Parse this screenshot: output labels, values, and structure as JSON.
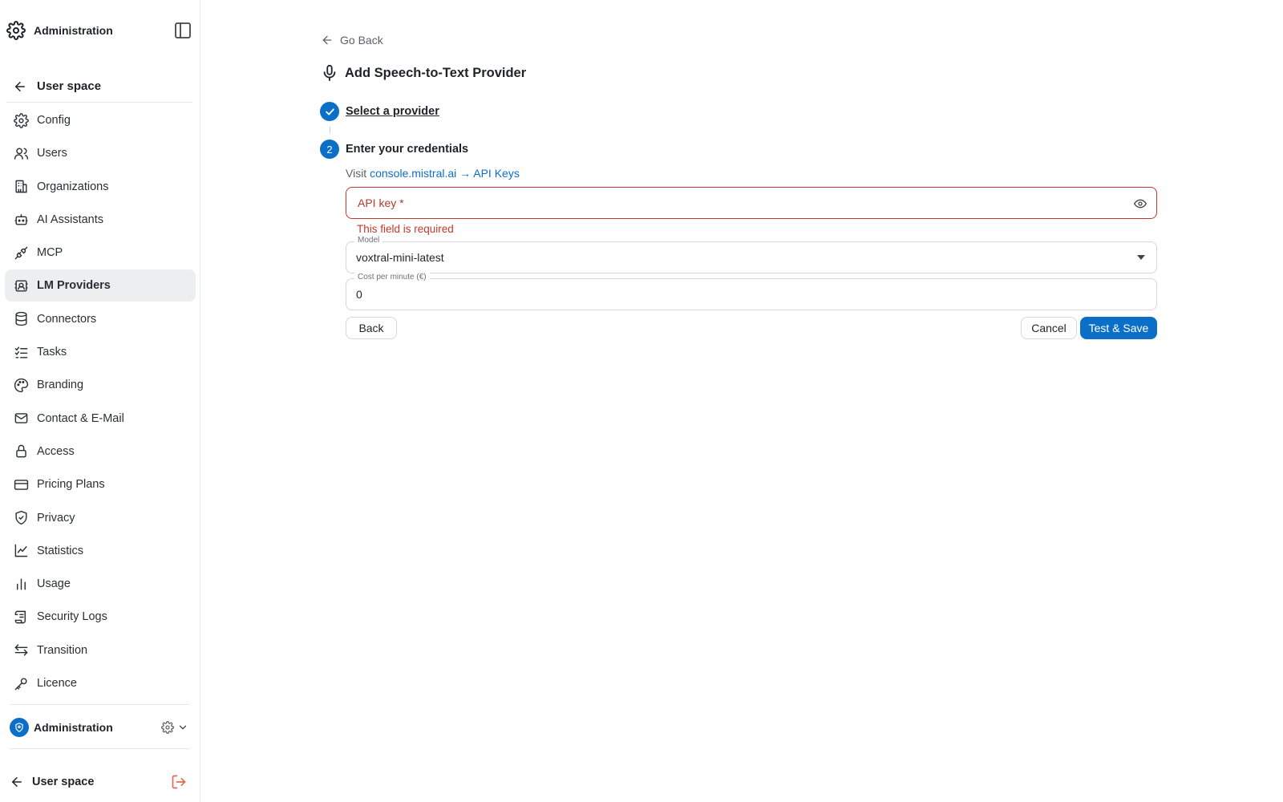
{
  "sidebar": {
    "header_title": "Administration",
    "back_label": "User space",
    "items": [
      {
        "label": "Config",
        "icon": "gear-icon",
        "active": false
      },
      {
        "label": "Users",
        "icon": "users-icon",
        "active": false
      },
      {
        "label": "Organizations",
        "icon": "building-icon",
        "active": false
      },
      {
        "label": "AI Assistants",
        "icon": "bot-icon",
        "active": false
      },
      {
        "label": "MCP",
        "icon": "plug-icon",
        "active": false
      },
      {
        "label": "LM Providers",
        "icon": "cpu-icon",
        "active": true
      },
      {
        "label": "Connectors",
        "icon": "database-icon",
        "active": false
      },
      {
        "label": "Tasks",
        "icon": "checklist-icon",
        "active": false
      },
      {
        "label": "Branding",
        "icon": "palette-icon",
        "active": false
      },
      {
        "label": "Contact & E-Mail",
        "icon": "mail-icon",
        "active": false
      },
      {
        "label": "Access",
        "icon": "lock-icon",
        "active": false
      },
      {
        "label": "Pricing Plans",
        "icon": "credit-card-icon",
        "active": false
      },
      {
        "label": "Privacy",
        "icon": "shield-check-icon",
        "active": false
      },
      {
        "label": "Statistics",
        "icon": "line-chart-icon",
        "active": false
      },
      {
        "label": "Usage",
        "icon": "bar-chart-icon",
        "active": false
      },
      {
        "label": "Security Logs",
        "icon": "scroll-icon",
        "active": false
      },
      {
        "label": "Transition",
        "icon": "arrows-swap-icon",
        "active": false
      },
      {
        "label": "Licence",
        "icon": "key-icon",
        "active": false
      }
    ],
    "footer_workspace": "Administration",
    "footer_back_label": "User space"
  },
  "main": {
    "go_back": "Go Back",
    "title": "Add Speech-to-Text Provider",
    "steps": {
      "step1": {
        "label": "Select a provider"
      },
      "step2": {
        "number": "2",
        "label": "Enter your credentials"
      }
    },
    "visit_prefix": "Visit",
    "visit_link": "console.mistral.ai → API Keys",
    "api_key": {
      "placeholder": "API key *",
      "value": "",
      "error": "This field is required"
    },
    "model": {
      "label": "Model",
      "value": "voxtral-mini-latest"
    },
    "cost": {
      "label": "Cost per minute (€)",
      "value": "0"
    },
    "buttons": {
      "back": "Back",
      "cancel": "Cancel",
      "save": "Test & Save"
    }
  },
  "colors": {
    "accent": "#0b6fc7",
    "error": "#c0392b",
    "logout": "#e06b55",
    "active_bg": "#eceef0"
  }
}
